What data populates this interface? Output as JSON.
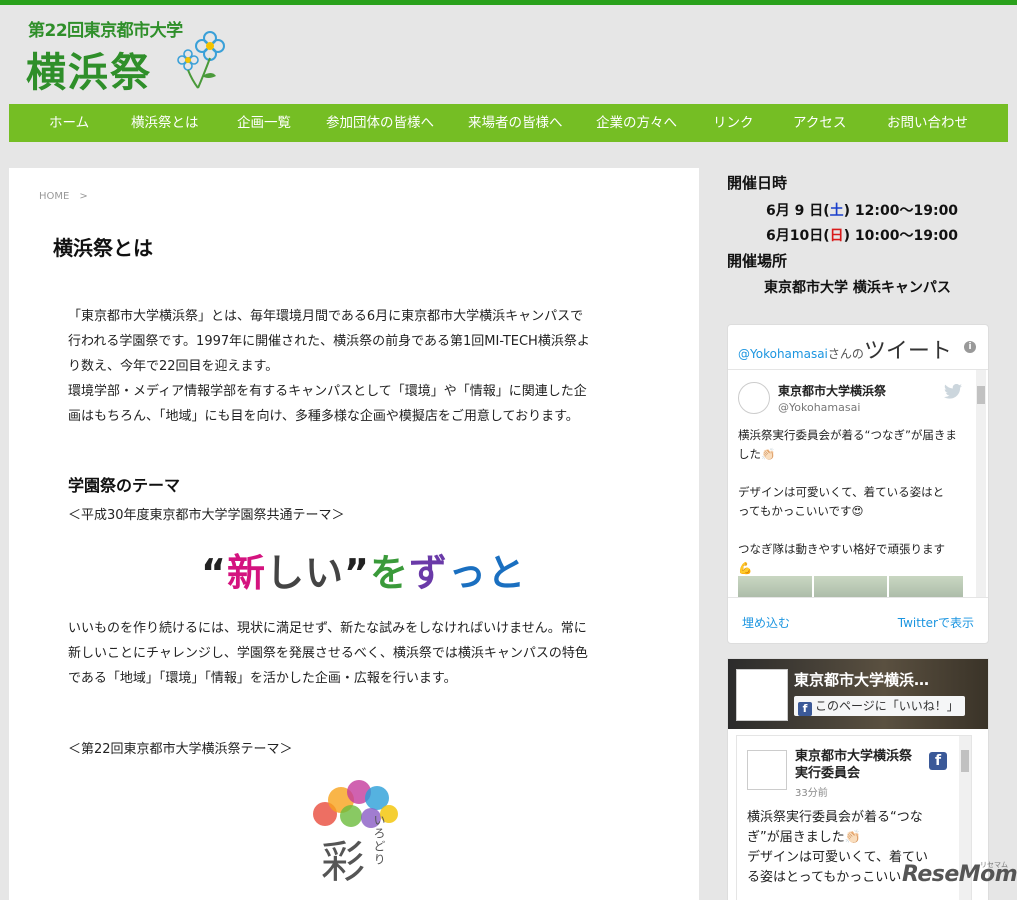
{
  "site": {
    "logo_line1": "第22回東京都市大学",
    "logo_line2": "横浜祭"
  },
  "nav": {
    "items": [
      "ホーム",
      "横浜祭とは",
      "企画一覧",
      "参加団体の皆様へ",
      "来場者の皆様へ",
      "企業の方々へ",
      "リンク",
      "アクセス",
      "お問い合わせ"
    ]
  },
  "main": {
    "breadcrumb": "HOME",
    "breadcrumb_sep": ">",
    "title": "横浜祭とは",
    "intro": "「東京都市大学横浜祭」とは、毎年環境月間である6月に東京都市大学横浜キャンパスで\n行われる学園祭です。1997年に開催された、横浜祭の前身である第1回MI-TECH横浜祭よ\nり数え、今年で22回目を迎えます。\n 環境学部・メディア情報学部を有するキャンパスとして「環境」や「情報」に関連した企\n画はもちろん、「地域」にも目を向け、多種多様な企画や模擬店をご用意しております。",
    "theme_heading": "学園祭のテーマ",
    "theme_sub": "＜平成30年度東京都市大学学園祭共通テーマ＞",
    "slogan": [
      "“",
      "新",
      "し",
      "い",
      "”",
      "を",
      "ず",
      "っ",
      "と"
    ],
    "slogan_colors": [
      "#222",
      "#d4137f",
      "#444",
      "#444",
      "#222",
      "#3a9a3a",
      "#6a3aa8",
      "#1a6fc0",
      "#1a6fc0"
    ],
    "theme_text": " いいものを作り続けるには、現状に満足せず、新たな試みをしなければいけません。常に\n新しいことにチャレンジし、学園祭を発展させるべく、横浜祭では横浜キャンパスの特色\nである「地域」「環境」「情報」を活かした企画・広報を行います。",
    "theme22_sub": "＜第22回東京都市大学横浜祭テーマ＞",
    "theme22_kanji": "彩",
    "theme22_kana": "いろどり"
  },
  "sidebar": {
    "date_heading": "開催日時",
    "date1": {
      "day": "6月 9 日(",
      "wd": "土",
      "close": ")",
      "time": "12:00～19:00"
    },
    "date2": {
      "day": "6月10日(",
      "wd": "日",
      "close": ")",
      "time": "10:00～19:00"
    },
    "place_heading": "開催場所",
    "place": "東京都市大学 横浜キャンパス"
  },
  "twitter": {
    "head_handle": "@Yokohamasai",
    "head_mid": "さんの",
    "head_label": "ツイート",
    "info": "i",
    "name": "東京都市大学横浜祭",
    "handle": "@Yokohamasai",
    "text": "横浜祭実行委員会が着る“つなぎ”が届きま\nした👏🏻\n\nデザインは可愛いくて、着ている姿はと\nってもかっこいいです😍\n\nつなぎ隊は動きやすい格好で頑張ります\n💪",
    "embed": "埋め込む",
    "view": "Twitterで表示"
  },
  "facebook": {
    "title": "東京都市大学横浜…",
    "like": "このページに「いいね！」",
    "f": "f",
    "post_name": "東京都市大学横浜祭\n実行委員会",
    "post_time": "33分前",
    "post_text": "横浜祭実行委員会が着る“つな\nぎ”が届きました👏🏻\nデザインは可愛いくて、着てい\nる姿はとってもかっこいい"
  },
  "watermark": {
    "brand": "ReseMom",
    "sub": "リセマム"
  }
}
